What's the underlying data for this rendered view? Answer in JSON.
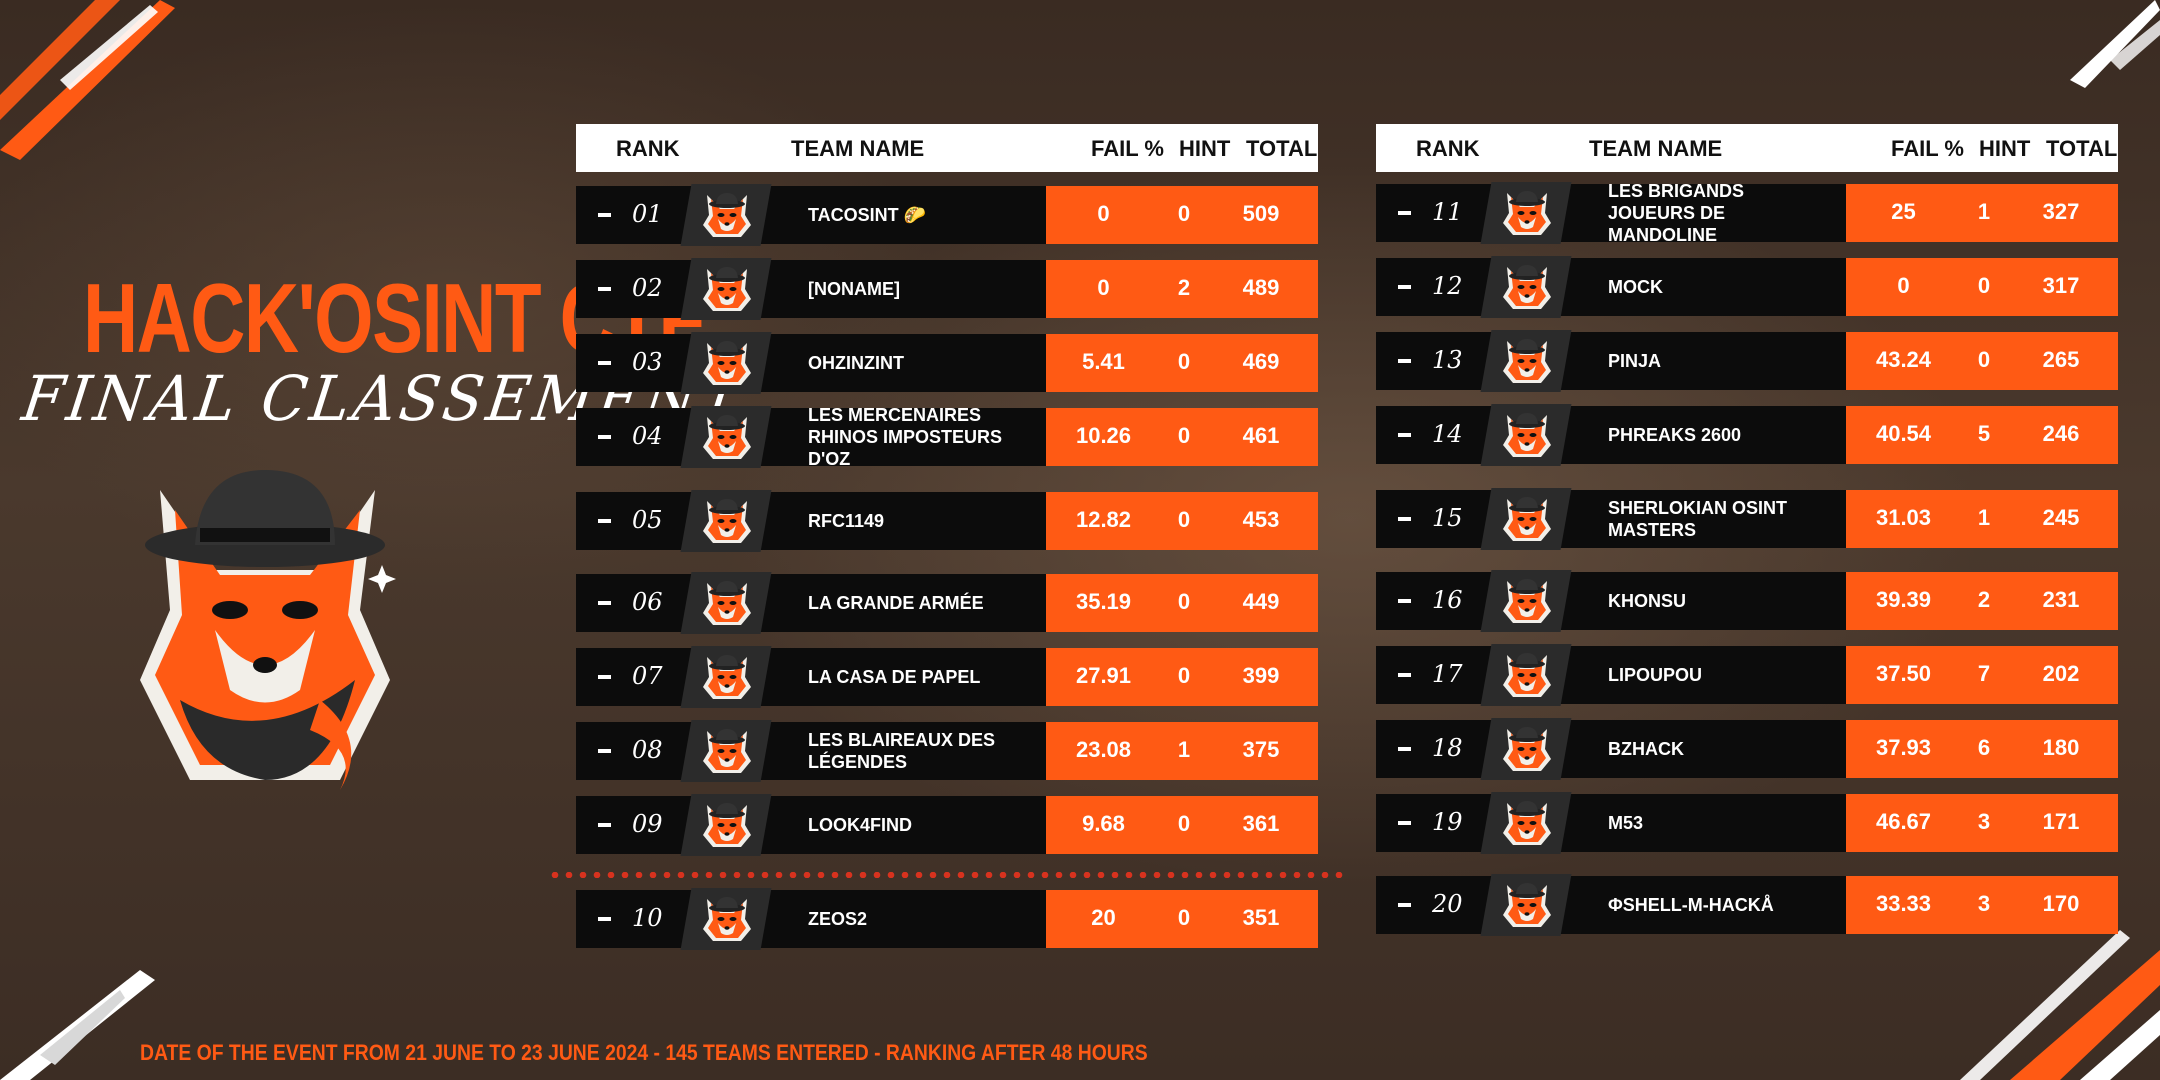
{
  "title": "HACK'OSINT CTF",
  "subtitle": "FINAL CLASSEMENT",
  "footer": "DATE OF THE EVENT FROM 21 JUNE TO 23 JUNE 2024 - 145 TEAMS ENTERED - RANKING AFTER 48 HOURS",
  "colors": {
    "accent": "#ff5a14",
    "row_bg": "#0c0c0c",
    "header_bg": "#ffffff"
  },
  "headers": {
    "rank": "RANK",
    "team": "TEAM NAME",
    "fail": "FAIL %",
    "hint": "HINT",
    "total": "TOTAL"
  },
  "left_rows": [
    {
      "rank": "01",
      "team": "TACOSINT 🌮",
      "fail": "0",
      "hint": "0",
      "total": "509",
      "avatar": "alpha-avatar"
    },
    {
      "rank": "02",
      "team": "[NONAME]",
      "fail": "0",
      "hint": "2",
      "total": "489",
      "avatar": "bravo-avatar"
    },
    {
      "rank": "03",
      "team": "OHZINZINT",
      "fail": "5.41",
      "hint": "0",
      "total": "469",
      "avatar": "charlie-avatar"
    },
    {
      "rank": "04",
      "team": "LES MERCENAIRES RHINOS IMPOSTEURS D'OZ",
      "fail": "10.26",
      "hint": "0",
      "total": "461",
      "avatar": "finisher-avatar"
    },
    {
      "rank": "05",
      "team": "RFC1149",
      "fail": "12.82",
      "hint": "0",
      "total": "453",
      "avatar": "fox-avatar"
    },
    {
      "rank": "06",
      "team": "LA GRANDE ARMÉE",
      "fail": "35.19",
      "hint": "0",
      "total": "449",
      "avatar": "fox-avatar"
    },
    {
      "rank": "07",
      "team": "LA CASA DE PAPEL",
      "fail": "27.91",
      "hint": "0",
      "total": "399",
      "avatar": "fox-avatar"
    },
    {
      "rank": "08",
      "team": "LES BLAIREAUX DES LÉGENDES",
      "fail": "23.08",
      "hint": "1",
      "total": "375",
      "avatar": "fox-avatar"
    },
    {
      "rank": "09",
      "team": "LOOK4FIND",
      "fail": "9.68",
      "hint": "0",
      "total": "361",
      "avatar": "fox-avatar"
    },
    {
      "rank": "10",
      "team": "ZEOS2",
      "fail": "20",
      "hint": "0",
      "total": "351",
      "avatar": "fox-avatar"
    }
  ],
  "right_rows": [
    {
      "rank": "11",
      "team": "LES BRIGANDS JOUEURS DE MANDOLINE",
      "fail": "25",
      "hint": "1",
      "total": "327",
      "avatar": "fox-avatar"
    },
    {
      "rank": "12",
      "team": "MOCK",
      "fail": "0",
      "hint": "0",
      "total": "317",
      "avatar": "fox-avatar"
    },
    {
      "rank": "13",
      "team": "PINJA",
      "fail": "43.24",
      "hint": "0",
      "total": "265",
      "avatar": "fox-avatar"
    },
    {
      "rank": "14",
      "team": "PHREAKS 2600",
      "fail": "40.54",
      "hint": "5",
      "total": "246",
      "avatar": "fox-avatar"
    },
    {
      "rank": "15",
      "team": "SHERLOKIAN OSINT MASTERS",
      "fail": "31.03",
      "hint": "1",
      "total": "245",
      "avatar": "fox-avatar"
    },
    {
      "rank": "16",
      "team": "KHONSU",
      "fail": "39.39",
      "hint": "2",
      "total": "231",
      "avatar": "fox-avatar"
    },
    {
      "rank": "17",
      "team": "LIPOUPOU",
      "fail": "37.50",
      "hint": "7",
      "total": "202",
      "avatar": "fox-avatar"
    },
    {
      "rank": "18",
      "team": "BZHACK",
      "fail": "37.93",
      "hint": "6",
      "total": "180",
      "avatar": "fox-avatar"
    },
    {
      "rank": "19",
      "team": "M53",
      "fail": "46.67",
      "hint": "3",
      "total": "171",
      "avatar": "fox-avatar"
    },
    {
      "rank": "20",
      "team": "ΦSHELL-M-HACKÅ",
      "fail": "33.33",
      "hint": "3",
      "total": "170",
      "avatar": "fox-avatar"
    }
  ]
}
